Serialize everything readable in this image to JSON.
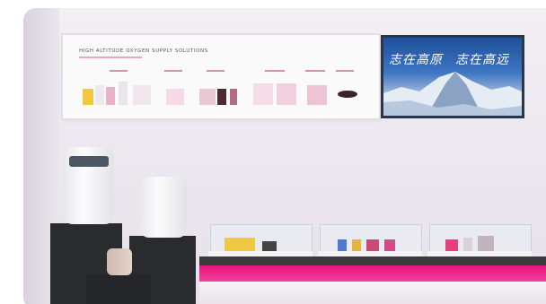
{
  "lightbox": {
    "title": "HIGH ALTITUDE OXYGEN SUPPLY SOLUTIONS"
  },
  "screen": {
    "text_left": "志在高原",
    "text_right": "志在高远"
  },
  "colors": {
    "accent_magenta": "#e3137b",
    "pedestal": "#2a2b2e",
    "sky_blue": "#1c4f9a"
  }
}
